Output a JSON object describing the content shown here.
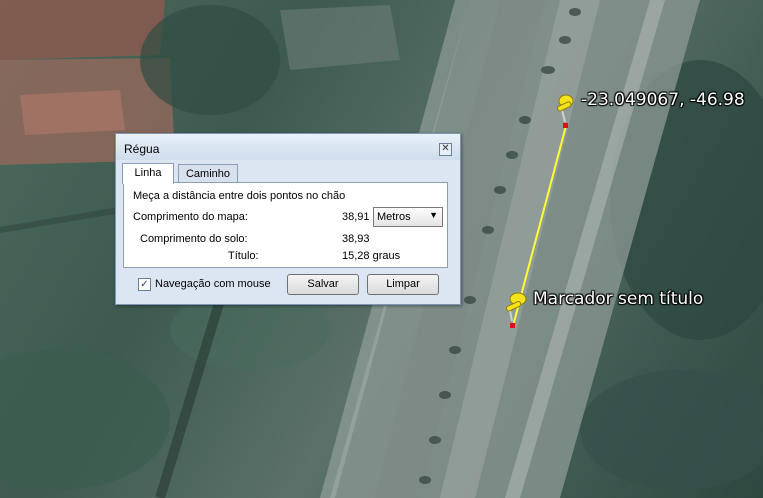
{
  "map": {
    "placemarks": [
      {
        "label": "-23.049067, -46.98"
      },
      {
        "label": "Marcador sem título"
      }
    ],
    "measure_line_color": "#ffff33",
    "pin_color": "#f5e21a",
    "endpoint_color": "#e01010"
  },
  "dialog": {
    "title": "Régua",
    "close_symbol": "✕",
    "tabs": [
      {
        "label": "Linha",
        "selected": true
      },
      {
        "label": "Caminho",
        "selected": false
      }
    ],
    "instruction": "Meça a distância entre dois pontos no chão",
    "map_length": {
      "label": "Comprimento do mapa:",
      "value": "38,91"
    },
    "units": {
      "selected": "Metros"
    },
    "ground_length": {
      "label": "Comprimento do solo:",
      "value": "38,93"
    },
    "heading": {
      "label": "Título:",
      "value": "15,28 graus"
    },
    "mouse_navigation": {
      "label": "Navegação com mouse",
      "checked": true,
      "check_symbol": "✓"
    },
    "buttons": {
      "save": "Salvar",
      "clear": "Limpar"
    }
  }
}
